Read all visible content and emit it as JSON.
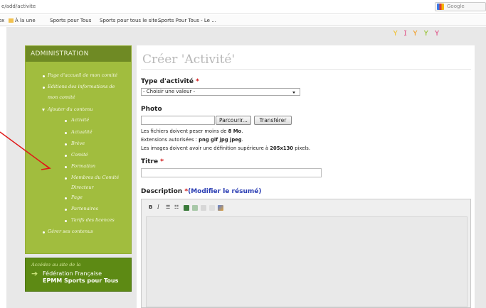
{
  "browser": {
    "url": "e/add/activite",
    "search_placeholder": "Google",
    "bookmarks": [
      "À la une",
      "Sports pour Tous",
      "Sports pour tous le site...",
      "Sports Pour Tous - Le ..."
    ]
  },
  "sidebar": {
    "heading": "ADMINISTRATION",
    "items": [
      "Page d'accueil de mon comité",
      "Editions des informations de",
      "mon comité",
      "Ajouter du contenu",
      "Activité",
      "Actualité",
      "Brève",
      "Comité",
      "Formation",
      "Membres du Comité",
      "Directeur",
      "Page",
      "Partenaires",
      "Tarifs des licences",
      "Gérer ses contenus"
    ],
    "promo": {
      "line1": "Accédez au site de la",
      "line2": "Fédération Française",
      "line3": "EPMM Sports pour Tous"
    }
  },
  "form": {
    "title": "Créer 'Activité'",
    "type_label": "Type d'activité",
    "required_mark": "*",
    "type_value": "- Choisir une valeur -",
    "photo_label": "Photo",
    "browse_button": "Parcourir...",
    "upload_button": "Transférer",
    "help_lines": [
      {
        "prefix": "Les fichiers doivent peser moins de ",
        "bold": "8 Mo",
        "suffix": "."
      },
      {
        "prefix": "Extensions autorisées : ",
        "bold": "png gif jpg jpeg",
        "suffix": "."
      },
      {
        "prefix": "Les images doivent avoir une définition supérieure à ",
        "bold": "205x130",
        "suffix": " pixels."
      }
    ],
    "titre_label": "Titre",
    "description_label": "Description",
    "summary_open": "(",
    "summary_link": "Modifier le résumé",
    "summary_close": ")",
    "toolbar": {
      "bold": "B",
      "italic": "I",
      "bullet_list": "☰",
      "numbered_list": "☷"
    }
  },
  "colors": {
    "sidebar_bg": "#a1bd3e",
    "sidebar_head": "#6f8a24",
    "promo_bg": "#5d8a14",
    "required": "#d01010",
    "link": "#2a3db3",
    "annotation": "#e01818"
  }
}
